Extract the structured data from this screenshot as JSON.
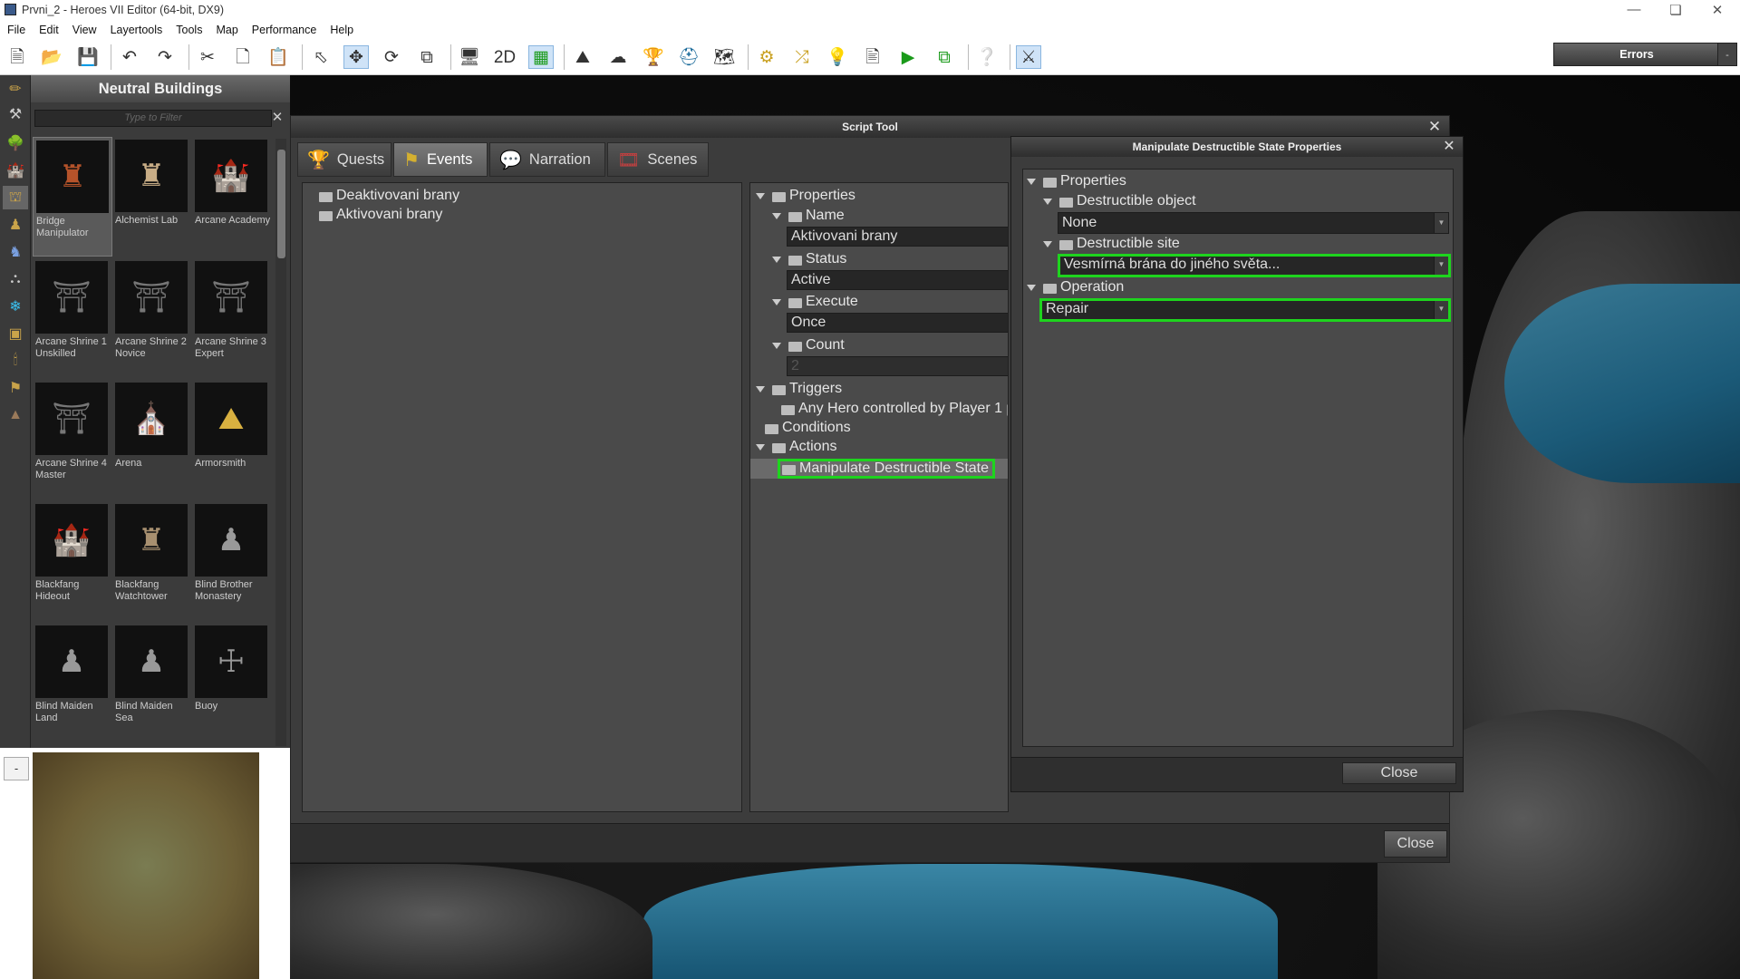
{
  "window": {
    "title": "Prvni_2 - Heroes VII Editor (64-bit, DX9)"
  },
  "menu": [
    "File",
    "Edit",
    "View",
    "Layertools",
    "Tools",
    "Map",
    "Performance",
    "Help"
  ],
  "errors_label": "Errors",
  "browser": {
    "title": "Neutral Buildings",
    "filter_placeholder": "Type to Filter",
    "items": [
      {
        "label": "Bridge Manipulator",
        "icon": "tower-icon"
      },
      {
        "label": "Alchemist Lab",
        "icon": "tower-icon"
      },
      {
        "label": "Arcane Academy",
        "icon": "castle-icon"
      },
      {
        "label": "Arcane Shrine 1 Unskilled",
        "icon": "shrine-icon"
      },
      {
        "label": "Arcane Shrine 2 Novice",
        "icon": "shrine-icon"
      },
      {
        "label": "Arcane Shrine 3 Expert",
        "icon": "shrine-icon"
      },
      {
        "label": "Arcane Shrine 4 Master",
        "icon": "shrine-icon"
      },
      {
        "label": "Arena",
        "icon": "arena-icon"
      },
      {
        "label": "Armorsmith",
        "icon": "dome-icon"
      },
      {
        "label": "Blackfang Hideout",
        "icon": "castle-icon"
      },
      {
        "label": "Blackfang Watchtower",
        "icon": "tower-icon"
      },
      {
        "label": "Blind Brother Monastery",
        "icon": "statue-icon"
      },
      {
        "label": "Blind Maiden Land",
        "icon": "statue-icon"
      },
      {
        "label": "Blind Maiden Sea",
        "icon": "statue-icon"
      },
      {
        "label": "Buoy",
        "icon": "buoy-icon"
      }
    ],
    "selected_index": 0
  },
  "minimap_button": "-",
  "script_tool": {
    "title": "Script Tool",
    "tabs": [
      {
        "label": "Quests",
        "icon": "trophy-icon"
      },
      {
        "label": "Events",
        "icon": "flag-icon"
      },
      {
        "label": "Narration",
        "icon": "speech-icon"
      },
      {
        "label": "Scenes",
        "icon": "film-icon"
      }
    ],
    "active_tab": "Events",
    "events": [
      "Deaktivovani brany",
      "Aktivovani brany"
    ],
    "properties": {
      "root": "Properties",
      "name_label": "Name",
      "name_value": "Aktivovani brany",
      "status_label": "Status",
      "status_value": "Active",
      "execute_label": "Execute",
      "execute_value": "Once",
      "count_label": "Count",
      "count_value": "2",
      "triggers_label": "Triggers",
      "trigger_item": "Any Hero controlled by Player 1 p",
      "conditions_label": "Conditions",
      "actions_label": "Actions",
      "action_item": "Manipulate Destructible State"
    },
    "close_label": "Close"
  },
  "mds": {
    "title": "Manipulate Destructible State Properties",
    "root": "Properties",
    "object_label": "Destructible object",
    "object_value": "None",
    "site_label": "Destructible site",
    "site_value": "Vesmírná brána do jiného světa...",
    "operation_label": "Operation",
    "operation_value": "Repair",
    "close_label": "Close"
  },
  "colors": {
    "highlight": "#1ed41e",
    "panel": "#3c3c3c"
  }
}
